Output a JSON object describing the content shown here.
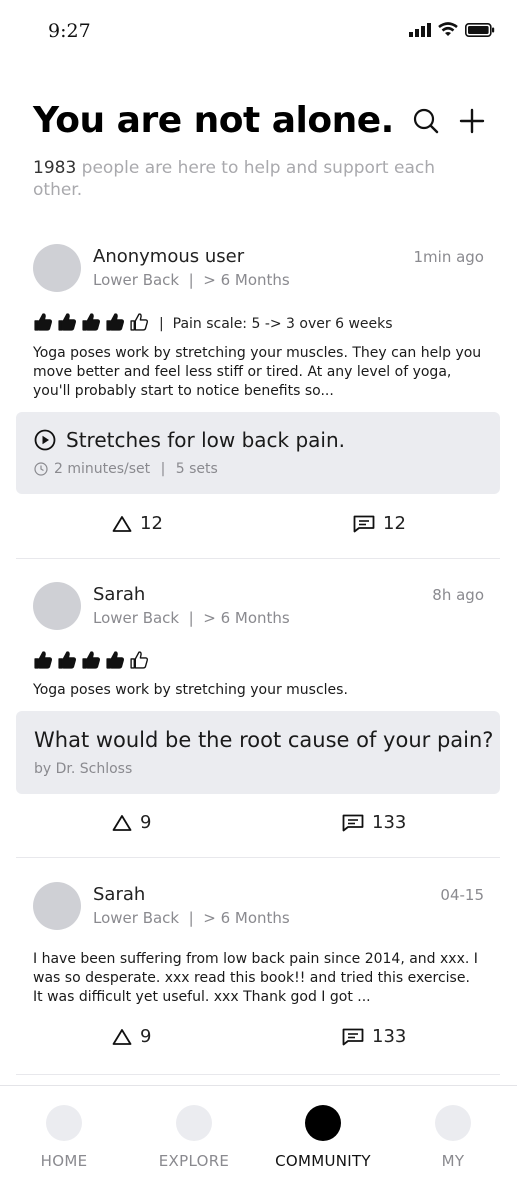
{
  "status_bar": {
    "time": "9:27"
  },
  "header": {
    "title": "You are not alone.",
    "subtitle_count": "1983",
    "subtitle_text": " people are here to help and support each other.",
    "search_icon": "search-icon",
    "add_icon": "plus-icon"
  },
  "posts": [
    {
      "user": "Anonymous user",
      "area": "Lower Back",
      "duration": "> 6 Months",
      "time": "1min ago",
      "rating": 4,
      "rating_max": 5,
      "pain_scale": "Pain scale: 5 -> 3 over 6 weeks",
      "body": "Yoga poses work by stretching your muscles. They can help you move better and feel less stiff or tired. At any level of yoga, you'll probably start to notice benefits so...",
      "card": {
        "title": "Stretches for low back pain.",
        "meta_time": "2 minutes/set",
        "meta_sets": "5 sets"
      },
      "likes": "12",
      "comments": "12"
    },
    {
      "user": "Sarah",
      "area": "Lower Back",
      "duration": "> 6 Months",
      "time": "8h ago",
      "rating": 4,
      "rating_max": 5,
      "body": "Yoga poses work by stretching your muscles.",
      "card": {
        "title": "What would be the root cause of your pain?",
        "by": "by  Dr. Schloss"
      },
      "likes": "9",
      "comments": "133"
    },
    {
      "user": "Sarah",
      "area": "Lower Back",
      "duration": "> 6 Months",
      "time": "04-15",
      "body": "I have been suffering from low back pain since 2014, and xxx. I was so desperate. xxx read this book!! and tried this exercise. It was difficult yet useful. xxx Thank god I got ...",
      "likes": "9",
      "comments": "133"
    }
  ],
  "nav": [
    {
      "label": "HOME",
      "active": false
    },
    {
      "label": "EXPLORE",
      "active": false
    },
    {
      "label": "COMMUNITY",
      "active": true
    },
    {
      "label": "MY",
      "active": false
    }
  ],
  "colors": {
    "accent": "#000000",
    "card_bg": "#ebecf0",
    "avatar": "#cfd0d5",
    "muted": "#8a8a8f"
  }
}
